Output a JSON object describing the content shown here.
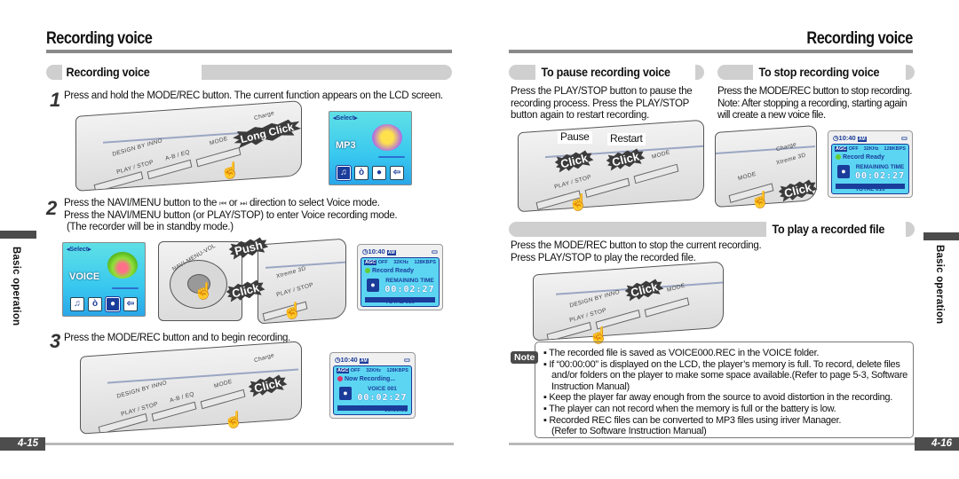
{
  "left_page": {
    "title": "Recording voice",
    "section_heading": "Recording voice",
    "steps": [
      {
        "number": "1",
        "text": "Press and hold the MODE/REC button. The current function appears on the LCD screen."
      },
      {
        "number": "2",
        "lines": [
          "Press the NAVI/MENU button to the",
          "or",
          "direction to select Voice mode.",
          "Press the NAVI/MENU button (or PLAY/STOP) to enter Voice recording mode.",
          "(The recorder will be in standby mode.)"
        ],
        "prev_icon": "⏮",
        "next_icon": "⏭"
      },
      {
        "number": "3",
        "text": "Press the MODE/REC button and to begin recording."
      }
    ],
    "side_label": "Basic operation",
    "page_number": "4-15"
  },
  "right_page": {
    "title": "Recording voice",
    "sections": {
      "pause": {
        "heading": "To pause recording voice",
        "text": "Press the PLAY/STOP button to pause the recording process.  Press the PLAY/STOP button again to restart recording.",
        "callouts": [
          "Pause",
          "Restart"
        ]
      },
      "stop": {
        "heading": "To stop recording voice",
        "text": "Press the MODE/REC button to stop recording. Note: After stopping a recording, starting again will create a new voice file."
      },
      "play": {
        "heading": "To play a recorded file",
        "lines": [
          "Press the MODE/REC button to stop the current recording.",
          "Press PLAY/STOP to play the recorded file."
        ]
      }
    },
    "note": {
      "tag": "Note",
      "items": [
        "The recorded file is saved as VOICE000.REC in the VOICE folder.",
        "If “00:00:00” is displayed on the LCD, the player’s memory is full.  To record, delete files and/or folders on the player to make some space available.(Refer to page 5-3, Software Instruction Manual)",
        "Keep the player far away enough from the source to avoid distortion in the recording.",
        "The player can not record when the memory is full or the battery is low.",
        "Recorded REC files can be converted to MP3 files using iriver Manager.\n(Refer  to Software Instruction Manual)"
      ]
    },
    "side_label": "Basic operation",
    "page_number": "4-16"
  },
  "device": {
    "brand": "DESIGN BY INNO",
    "buttons": {
      "play_stop": "PLAY / STOP",
      "ab_eq": "A-B / EQ",
      "mode": "MODE",
      "xtreme": "Xtreme 3D",
      "charge": "Charge",
      "navi": "NAVI-MENU-VOL"
    }
  },
  "callouts": {
    "long_click": "Long Click",
    "click": "Click",
    "push": "Push"
  },
  "lcd_menu": {
    "select": "Select",
    "mp3_label": "MP3",
    "voice_label": "VOICE",
    "icons": [
      "♫",
      "ò",
      "🎙",
      "⇦"
    ]
  },
  "lcd_standby": {
    "clock": "10:40",
    "ampm": "AM",
    "agc": "AGC",
    "agc_state": "OFF",
    "sample_rate": "32KHz",
    "bitrate": "128KBPS",
    "status": "Record Ready",
    "status_color": "#66cc33",
    "label": "REMAINING TIME",
    "time": "00:02:27",
    "footer": "TOTAL 010"
  },
  "lcd_recording": {
    "clock": "10:40",
    "ampm": "AM",
    "agc": "AGC",
    "agc_state": "OFF",
    "sample_rate": "32KHz",
    "bitrate": "128KBPS",
    "status": "Now Recording...",
    "status_color": "#e0306a",
    "label": "VOICE 001",
    "time": "00:02:27",
    "footer": "00:00:05"
  },
  "colors": {
    "lcd_blue": "#1a3c9a",
    "lcd_cyan": "#5cd5f2",
    "section_gray": "#cfcfcf",
    "tab_dark": "#4b4b4b"
  }
}
